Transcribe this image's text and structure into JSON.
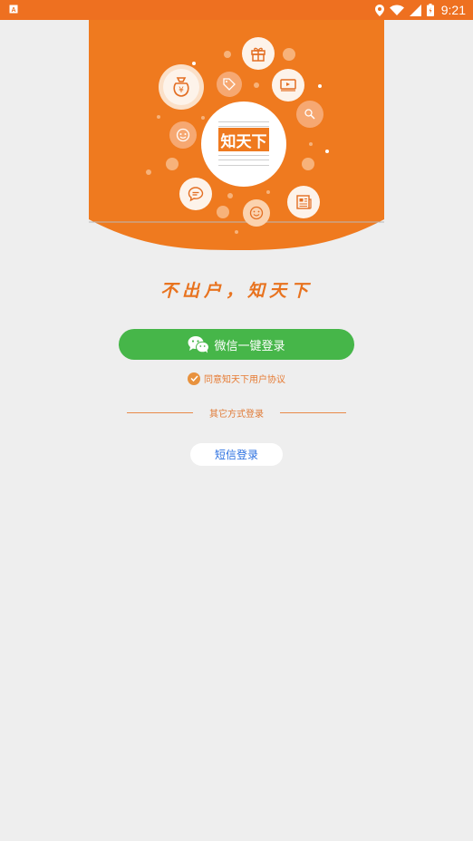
{
  "status_bar": {
    "time": "9:21",
    "notification_icon": "a-box-icon",
    "icons": [
      "location-icon",
      "wifi-icon",
      "signal-icon",
      "battery-icon"
    ]
  },
  "hero": {
    "logo_text": "知天下",
    "icons": [
      "money-bag-icon",
      "tag-icon",
      "gift-icon",
      "video-icon",
      "search-doc-icon",
      "face-icon",
      "chat-icon",
      "smile-icon",
      "newspaper-icon"
    ]
  },
  "slogan": "不出户，知天下",
  "wechat_login": {
    "label": "微信一键登录",
    "icon": "wechat-icon"
  },
  "agreement": {
    "label": "同意知天下用户协议",
    "checked": true
  },
  "other_methods": {
    "label": "其它方式登录"
  },
  "sms_login": {
    "label": "短信登录"
  },
  "colors": {
    "status_bar": "#ee7020",
    "hero_orange": "#ef7a1f",
    "wechat_green": "#46b649",
    "accent_orange": "#e67a32",
    "sms_blue": "#2a6fe0",
    "background": "#eeeeee"
  }
}
